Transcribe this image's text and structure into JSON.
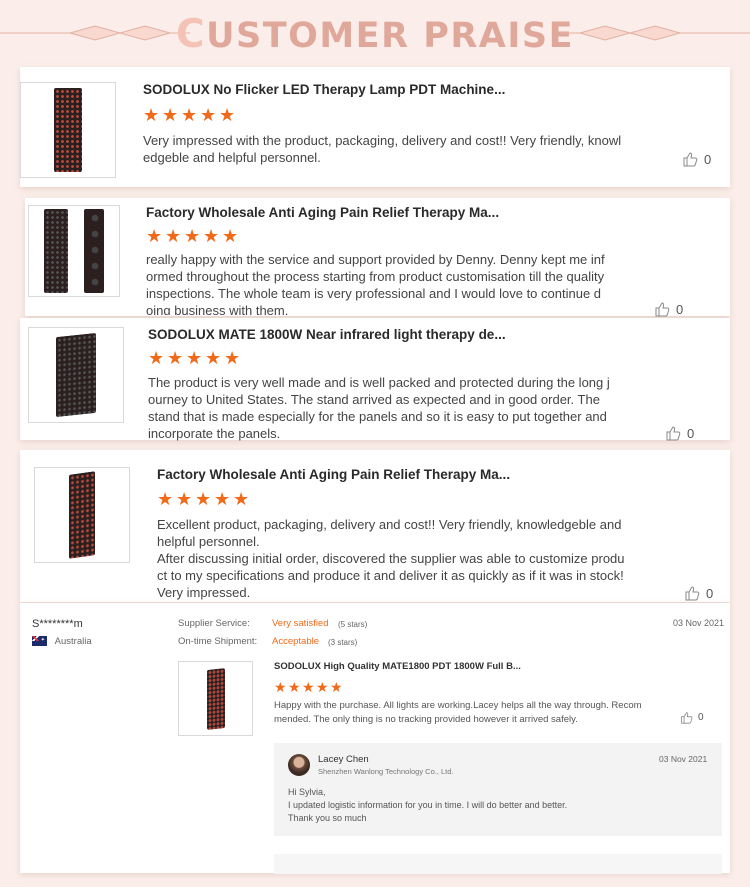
{
  "header": {
    "title_first": "C",
    "title_rest": "USTOMER PRAISE"
  },
  "reviews": [
    {
      "title": "SODOLUX No Flicker LED Therapy Lamp PDT Machine...",
      "text": "Very impressed with the product, packaging, delivery and cost!!  Very friendly, knowledgeble and helpful personnel.",
      "likes": "0"
    },
    {
      "title": "Factory Wholesale Anti Aging Pain Relief Therapy Ma...",
      "text": "really happy with the service and support provided by Denny. Denny kept me informed throughout the process starting from product customisation till the quality inspections. The whole team is very professional and I would love to continue doing business with them.",
      "likes": "0"
    },
    {
      "title": "SODOLUX MATE 1800W Near infrared light therapy de...",
      "text": "The product is very well made and is well packed and protected during the long journey to United States. The stand arrived as expected and in good order. The stand that is made especially for the panels and so it is easy to put together and incorporate the panels.",
      "likes": "0"
    },
    {
      "title": "Factory Wholesale Anti Aging Pain Relief Therapy Ma...",
      "text": "Excellent product, packaging, delivery and cost!!  Very friendly, knowledgeble and helpful personnel.\nAfter discussing initial order, discovered the supplier was able to customize product to my specifications and produce it and deliver it as quickly as if it was in stock! Very impressed.",
      "likes": "0"
    }
  ],
  "detail": {
    "user": "S********m",
    "country": "Australia",
    "supplier_label": "Supplier Service:",
    "supplier_value": "Very satisfied",
    "supplier_stars": "(5 stars)",
    "shipment_label": "On-time Shipment:",
    "shipment_value": "Acceptable",
    "shipment_stars": "(3 stars)",
    "date": "03 Nov 2021",
    "product_title": "SODOLUX High Quality MATE1800 PDT 1800W Full B...",
    "text": "Happy with the purchase. All lights are working.Lacey helps all the way through. Recommended. The only thing is no tracking provided however it arrived safely.",
    "likes": "0",
    "reply": {
      "name": "Lacey Chen",
      "company": "Shenzhen Wanlong Technology Co., Ltd.",
      "date": "03 Nov 2021",
      "line1": "Hi Sylvia,",
      "line2": "I updated logistic information for you in time.  I will do better and better.",
      "line3": "Thank you so much"
    }
  },
  "colors": {
    "accent_orange": "#f06a1a",
    "title_pink": "#e0a89b",
    "background": "#fbeeea"
  }
}
